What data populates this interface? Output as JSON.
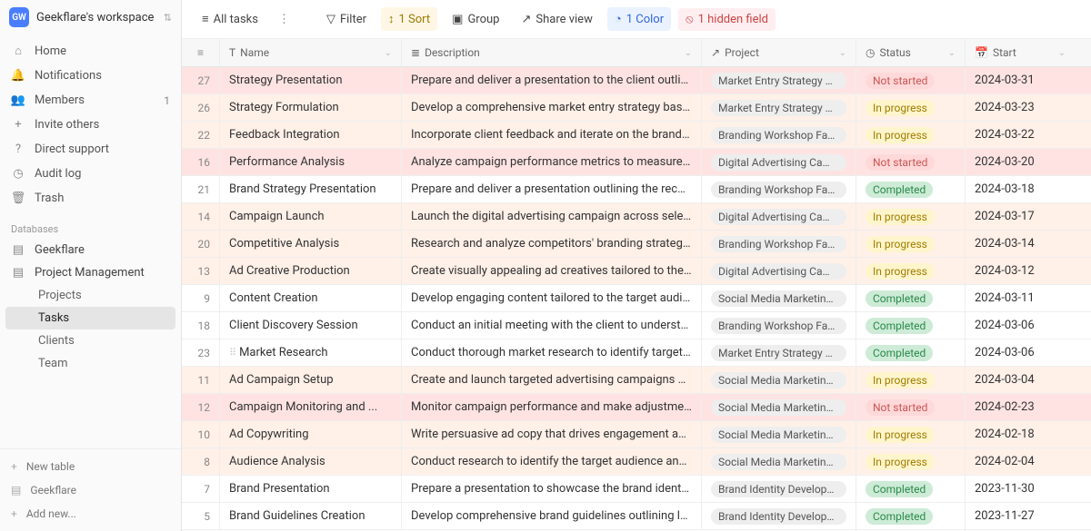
{
  "workspace": {
    "avatar": "GW",
    "name": "Geekflare's workspace"
  },
  "nav": {
    "home": "Home",
    "notifications": "Notifications",
    "members": "Members",
    "members_count": "1",
    "invite": "Invite others",
    "support": "Direct support",
    "audit": "Audit log",
    "trash": "Trash"
  },
  "db_label": "Databases",
  "databases": {
    "geekflare": "Geekflare",
    "pm": "Project Management",
    "subs": {
      "projects": "Projects",
      "tasks": "Tasks",
      "clients": "Clients",
      "team": "Team"
    }
  },
  "footer": {
    "new_table": "New table",
    "geekflare": "Geekflare",
    "add_new": "Add new..."
  },
  "toolbar": {
    "all_tasks": "All tasks",
    "filter": "Filter",
    "sort": "1 Sort",
    "group": "Group",
    "share": "Share view",
    "color": "1 Color",
    "hidden": "1 hidden field"
  },
  "columns": {
    "name": "Name",
    "description": "Description",
    "project": "Project",
    "status": "Status",
    "start": "Start"
  },
  "status_labels": {
    "not_started": "Not started",
    "in_progress": "In progress",
    "completed": "Completed"
  },
  "rows": [
    {
      "num": "27",
      "name": "Strategy Presentation",
      "desc": "Prepare and deliver a presentation to the client outlining ...",
      "project": "Market Entry Strategy Consult",
      "status": "not_started",
      "start": "2024-03-31"
    },
    {
      "num": "26",
      "name": "Strategy Formulation",
      "desc": "Develop a comprehensive market entry strategy based o...",
      "project": "Market Entry Strategy Consult",
      "status": "in_progress",
      "start": "2024-03-23"
    },
    {
      "num": "22",
      "name": "Feedback Integration",
      "desc": "Incorporate client feedback and iterate on the brand stra...",
      "project": "Branding Workshop Facilitation",
      "status": "in_progress",
      "start": "2024-03-22"
    },
    {
      "num": "16",
      "name": "Performance Analysis",
      "desc": "Analyze campaign performance metrics to measure succ...",
      "project": "Digital Advertising Campaign M",
      "status": "not_started",
      "start": "2024-03-20"
    },
    {
      "num": "21",
      "name": "Brand Strategy Presentation",
      "desc": "Prepare and deliver a presentation outlining the recomm...",
      "project": "Branding Workshop Facilitation",
      "status": "completed",
      "start": "2024-03-18"
    },
    {
      "num": "14",
      "name": "Campaign Launch",
      "desc": "Launch the digital advertising campaign across selected ...",
      "project": "Digital Advertising Campaign M",
      "status": "in_progress",
      "start": "2024-03-17"
    },
    {
      "num": "20",
      "name": "Competitive Analysis",
      "desc": "Research and analyze competitors' branding strategies a...",
      "project": "Branding Workshop Facilitation",
      "status": "in_progress",
      "start": "2024-03-14"
    },
    {
      "num": "13",
      "name": "Ad Creative Production",
      "desc": "Create visually appealing ad creatives tailored to the ca...",
      "project": "Digital Advertising Campaign M",
      "status": "in_progress",
      "start": "2024-03-12"
    },
    {
      "num": "9",
      "name": "Content Creation",
      "desc": "Develop engaging content tailored to the target audienc...",
      "project": "Social Media Marketing Campa",
      "status": "completed",
      "start": "2024-03-11"
    },
    {
      "num": "18",
      "name": "Client Discovery Session",
      "desc": "Conduct an initial meeting with the client to understand t...",
      "project": "Branding Workshop Facilitation",
      "status": "completed",
      "start": "2024-03-06"
    },
    {
      "num": "23",
      "name": "Market Research",
      "desc": "Conduct thorough market research to identify target mar...",
      "project": "Market Entry Strategy Consult",
      "status": "completed",
      "start": "2024-03-06",
      "hover": true
    },
    {
      "num": "11",
      "name": "Ad Campaign Setup",
      "desc": "Create and launch targeted advertising campaigns acros...",
      "project": "Social Media Marketing Campa",
      "status": "in_progress",
      "start": "2024-03-04"
    },
    {
      "num": "12",
      "name": "Campaign Monitoring and ...",
      "desc": "Monitor campaign performance and make adjustments t...",
      "project": "Social Media Marketing Campa",
      "status": "not_started",
      "start": "2024-02-23"
    },
    {
      "num": "10",
      "name": "Ad Copywriting",
      "desc": "Write persuasive ad copy that drives engagement and c...",
      "project": "Social Media Marketing Campa",
      "status": "in_progress",
      "start": "2024-02-18"
    },
    {
      "num": "8",
      "name": "Audience Analysis",
      "desc": "Conduct research to identify the target audience and th...",
      "project": "Social Media Marketing Campa",
      "status": "in_progress",
      "start": "2024-02-04"
    },
    {
      "num": "7",
      "name": "Brand Presentation",
      "desc": "Prepare a presentation to showcase the brand identity c...",
      "project": "Brand Identity Development",
      "status": "completed",
      "start": "2023-11-30"
    },
    {
      "num": "5",
      "name": "Brand Guidelines Creation",
      "desc": "Develop comprehensive brand guidelines outlining logo ...",
      "project": "Brand Identity Development",
      "status": "completed",
      "start": "2023-11-27"
    }
  ]
}
